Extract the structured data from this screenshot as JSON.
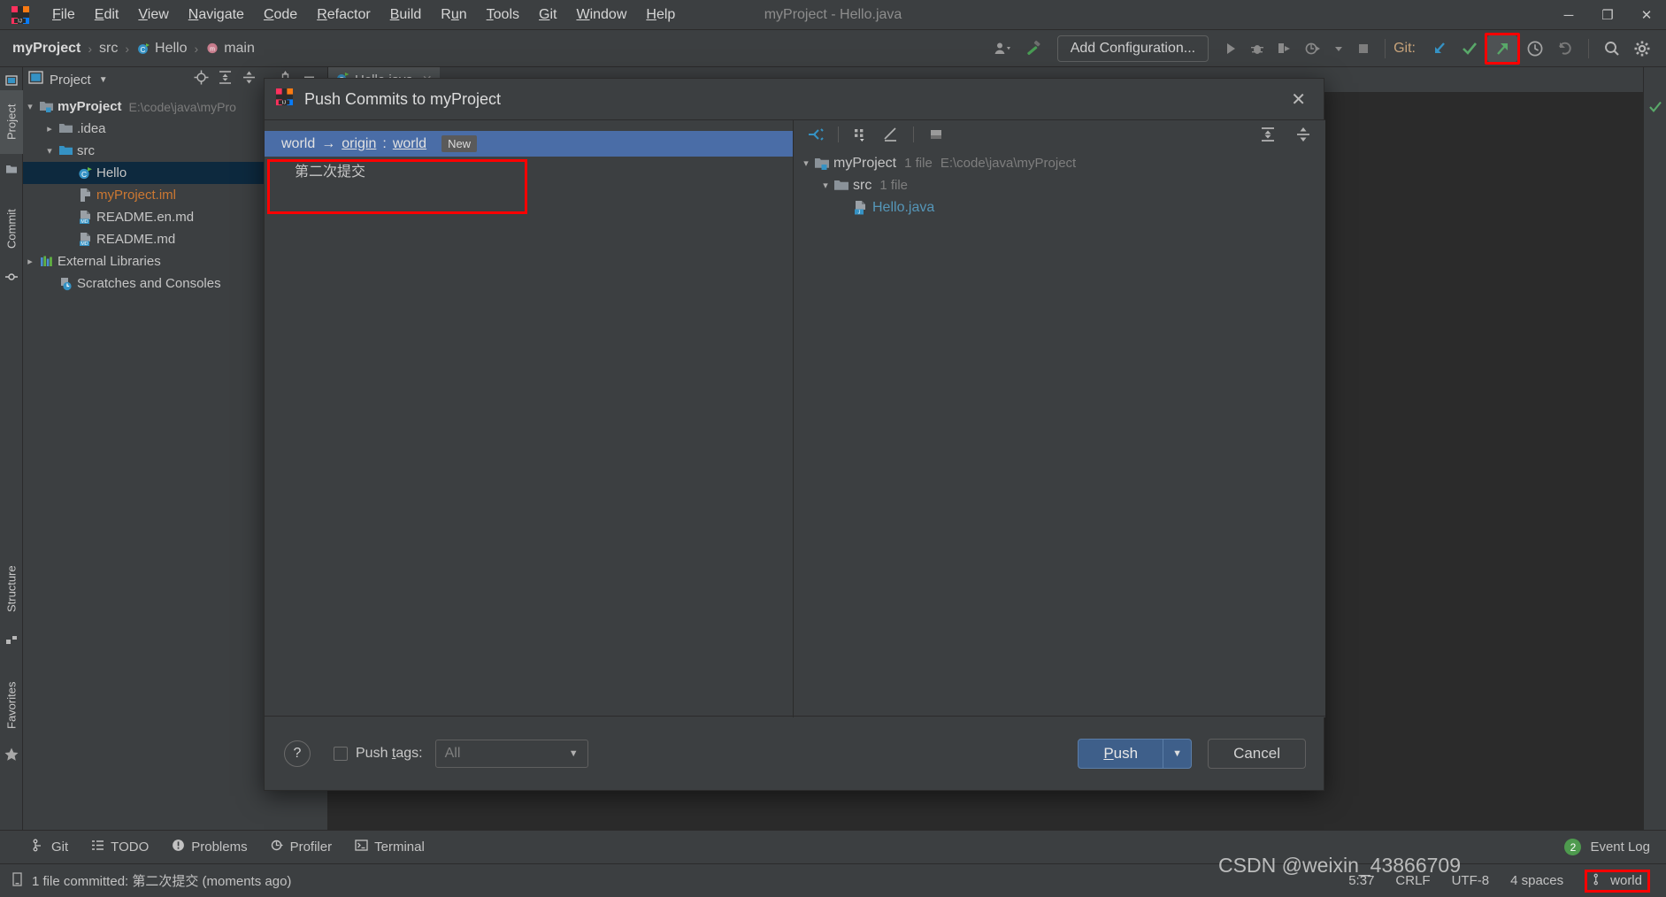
{
  "window": {
    "title": "myProject - Hello.java",
    "controls": {
      "minimize": "─",
      "maximize": "❐",
      "close": "✕"
    }
  },
  "menubar": {
    "items": [
      {
        "label": "File",
        "mnemonic": "F"
      },
      {
        "label": "Edit",
        "mnemonic": "E"
      },
      {
        "label": "View",
        "mnemonic": "V"
      },
      {
        "label": "Navigate",
        "mnemonic": "N"
      },
      {
        "label": "Code",
        "mnemonic": "C"
      },
      {
        "label": "Refactor",
        "mnemonic": "R"
      },
      {
        "label": "Build",
        "mnemonic": "B"
      },
      {
        "label": "Run",
        "mnemonic": "u"
      },
      {
        "label": "Tools",
        "mnemonic": "T"
      },
      {
        "label": "Git",
        "mnemonic": "G"
      },
      {
        "label": "Window",
        "mnemonic": "W"
      },
      {
        "label": "Help",
        "mnemonic": "H"
      }
    ]
  },
  "navbar": {
    "breadcrumbs": [
      {
        "label": "myProject",
        "icon": "none"
      },
      {
        "label": "src",
        "icon": "none"
      },
      {
        "label": "Hello",
        "icon": "java-class-icon"
      },
      {
        "label": "main",
        "icon": "method-icon"
      }
    ],
    "separator": "›",
    "add_configuration": "Add Configuration...",
    "git_label": "Git:",
    "icons": [
      "user-settings-icon",
      "build-hammer-icon",
      "run-icon",
      "debug-icon",
      "run-with-coverage-icon",
      "profile-icon",
      "dropdown-icon",
      "stop-icon",
      "git-update-icon",
      "git-commit-icon",
      "git-push-icon",
      "history-icon",
      "rollback-icon",
      "search-everywhere-icon",
      "settings-gear-icon"
    ],
    "highlighted_icon": "git-push-icon"
  },
  "left_strips": {
    "top": [
      {
        "label": "Project",
        "icon": "project-icon",
        "active": true
      },
      {
        "label": "Commit",
        "icon": "commit-icon",
        "active": false
      }
    ],
    "bottom": [
      {
        "label": "Structure",
        "icon": "structure-icon"
      },
      {
        "label": "Favorites",
        "icon": "star-icon"
      }
    ]
  },
  "project_tool": {
    "title": "Project",
    "header_icons": [
      "locate-icon",
      "expand-all-icon",
      "collapse-all-icon",
      "settings-icon",
      "hide-icon"
    ],
    "tree": [
      {
        "label": "myProject",
        "sub": "E:\\code\\java\\myPro",
        "indent": 0,
        "chevron": "down",
        "icon": "module-folder-icon",
        "bold": true,
        "selected": false,
        "color": "#d8d8d8"
      },
      {
        "label": ".idea",
        "sub": "",
        "indent": 1,
        "chevron": "right",
        "icon": "folder-icon",
        "bold": false,
        "selected": false,
        "color": "#c5c5c5"
      },
      {
        "label": "src",
        "sub": "",
        "indent": 1,
        "chevron": "down",
        "icon": "source-folder-icon",
        "bold": false,
        "selected": false,
        "color": "#c5c5c5"
      },
      {
        "label": "Hello",
        "sub": "",
        "indent": 2,
        "chevron": "none",
        "icon": "java-class-icon",
        "bold": false,
        "selected": true,
        "color": "#c5c5c5"
      },
      {
        "label": "myProject.iml",
        "sub": "",
        "indent": 2,
        "chevron": "none",
        "icon": "iml-file-icon",
        "bold": false,
        "selected": false,
        "color": "#cc7832"
      },
      {
        "label": "README.en.md",
        "sub": "",
        "indent": 2,
        "chevron": "none",
        "icon": "markdown-file-icon",
        "bold": false,
        "selected": false,
        "color": "#c5c5c5"
      },
      {
        "label": "README.md",
        "sub": "",
        "indent": 2,
        "chevron": "none",
        "icon": "markdown-file-icon",
        "bold": false,
        "selected": false,
        "color": "#c5c5c5"
      },
      {
        "label": "External Libraries",
        "sub": "",
        "indent": 0,
        "chevron": "right",
        "icon": "libraries-icon",
        "bold": false,
        "selected": false,
        "color": "#c5c5c5"
      },
      {
        "label": "Scratches and Consoles",
        "sub": "",
        "indent": 1,
        "chevron": "none",
        "icon": "scratches-icon",
        "bold": false,
        "selected": false,
        "color": "#c5c5c5"
      }
    ]
  },
  "editor": {
    "tabs": [
      {
        "label": "Hello.java",
        "icon": "java-class-icon",
        "close": "✕",
        "active": true
      }
    ]
  },
  "push_dialog": {
    "title": "Push Commits to myProject",
    "close_label": "✕",
    "commits": {
      "target_source": "world",
      "target_arrow": "→",
      "target_remote": "origin",
      "target_colon": ":",
      "target_branch": "world",
      "target_badge": "New",
      "commit_message": "第二次提交"
    },
    "files_toolbar_icons": [
      "expand-collapse-icon",
      "group-by-icon",
      "preview-diff-icon",
      "show-diff-icon",
      "expand-all-icon",
      "collapse-all-icon"
    ],
    "files_tree": [
      {
        "label": "myProject",
        "count": "1 file",
        "path": "E:\\code\\java\\myProject",
        "indent": 0,
        "chevron": "down",
        "icon": "module-folder-icon",
        "color": "#c5c5c5"
      },
      {
        "label": "src",
        "count": "1 file",
        "path": "",
        "indent": 1,
        "chevron": "down",
        "icon": "folder-icon",
        "color": "#c5c5c5"
      },
      {
        "label": "Hello.java",
        "count": "",
        "path": "",
        "indent": 2,
        "chevron": "none",
        "icon": "java-file-icon",
        "color": "#5596b8"
      }
    ],
    "footer": {
      "help_label": "?",
      "push_tags_label": "Push tags:",
      "push_tags_mnemonic": "t",
      "push_tags_checked": false,
      "tags_combo_value": "All",
      "tags_combo_arrow": "▼",
      "push_button": "Push",
      "push_mnemonic": "P",
      "push_dropdown_arrow": "▼",
      "cancel_button": "Cancel"
    }
  },
  "statusbar": {
    "tools": [
      {
        "label": "Git",
        "icon": "git-branch-icon"
      },
      {
        "label": "TODO",
        "icon": "todo-icon"
      },
      {
        "label": "Problems",
        "icon": "problems-icon"
      },
      {
        "label": "Profiler",
        "icon": "profiler-icon"
      },
      {
        "label": "Terminal",
        "icon": "terminal-icon"
      }
    ],
    "event_log": {
      "label": "Event Log",
      "count": "2"
    },
    "message": "1 file committed: 第二次提交 (moments ago)",
    "caret": "5:37",
    "line_separator": "CRLF",
    "encoding": "UTF-8",
    "indent": "4 spaces",
    "branch": "world",
    "branch_icon": "git-branch-icon"
  },
  "watermark": "CSDN @weixin_43866709",
  "colors": {
    "bg": "#3c3f41",
    "editor_bg": "#2b2b2b",
    "selection_blue": "#4a6da7",
    "tree_selection": "#0d293e",
    "highlight_red": "#ff0000",
    "accent_blue": "#5596b8",
    "iml_orange": "#cc7832",
    "git_green": "#59a869",
    "git_blue": "#3592c4"
  }
}
